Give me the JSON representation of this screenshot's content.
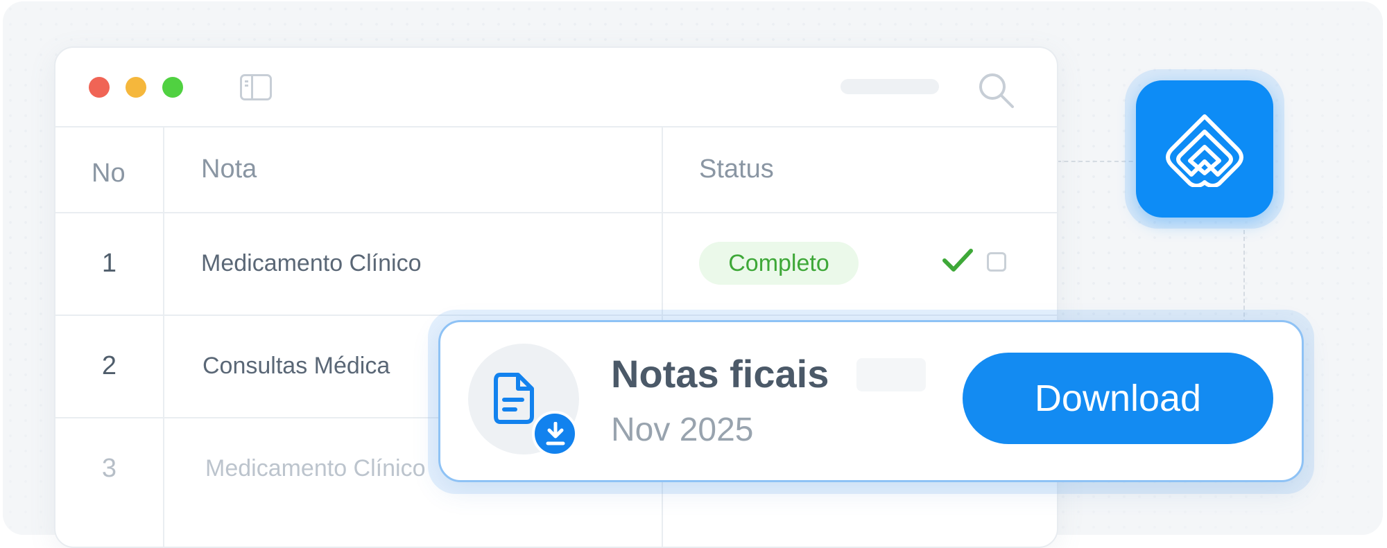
{
  "window": {
    "controls": [
      "close",
      "minimize",
      "maximize"
    ],
    "icons": {
      "sidebar": "sidebar-toggle-icon",
      "search": "search-icon"
    }
  },
  "table": {
    "columns": [
      "No",
      "Nota",
      "Status"
    ],
    "rows": [
      {
        "no": "1",
        "nota": "Medicamento Clínico",
        "status": "Completo"
      },
      {
        "no": "2",
        "nota": "Consultas Médica"
      },
      {
        "no": "3",
        "nota": "Medicamento Clínico"
      }
    ]
  },
  "brand": {
    "icon": "brand-logo-icon",
    "color": "#0D8CF6"
  },
  "card": {
    "title": "Notas ficais",
    "subtitle": "Nov 2025",
    "button_label": "Download",
    "icon": "document-download-icon",
    "accent": "#138BF2"
  },
  "colors": {
    "status_complete": "#3EA838",
    "badge_bg": "#EBF9EA"
  }
}
